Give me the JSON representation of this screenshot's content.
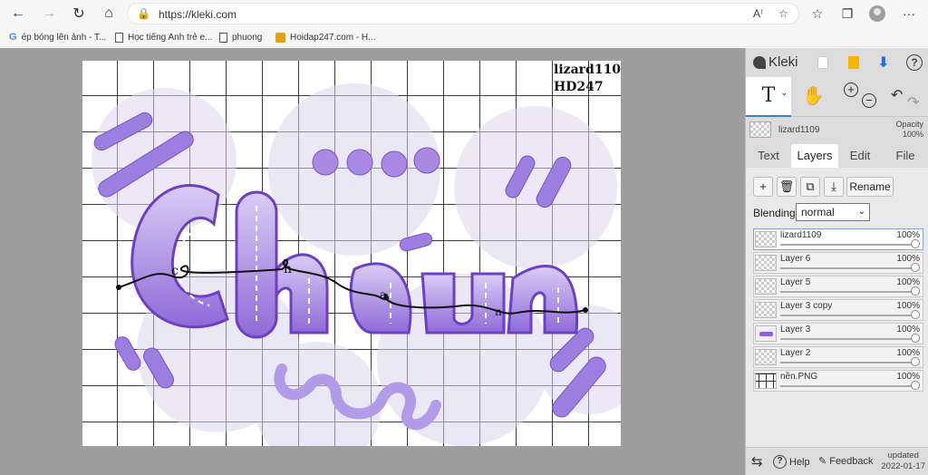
{
  "browser": {
    "url": "https://kleki.com",
    "bookmarks": [
      {
        "label": "ép bóng lên ảnh - T...",
        "icon": "google-icon"
      },
      {
        "label": "Học tiếng Anh trẻ e...",
        "icon": "page-icon"
      },
      {
        "label": "phuong",
        "icon": "page-icon"
      },
      {
        "label": "Hoidap247.com - H...",
        "icon": "hoidap-icon"
      }
    ]
  },
  "canvas": {
    "watermark_line1": "lizard1109",
    "watermark_line2": "HD247"
  },
  "panel": {
    "logo": "Kleki",
    "current_layer_name": "lizard1109",
    "opacity_label": "Opacity",
    "opacity_value": "100%",
    "tool_text_glyph": "T",
    "tabs": [
      {
        "label": "Text"
      },
      {
        "label": "Layers",
        "active": true
      },
      {
        "label": "Edit"
      },
      {
        "label": "File"
      }
    ],
    "rename_label": "Rename",
    "blending_label": "Blending",
    "blending_value": "normal",
    "layers": [
      {
        "name": "lizard1109",
        "opacity": "100%",
        "selected": true
      },
      {
        "name": "Layer 6",
        "opacity": "100%"
      },
      {
        "name": "Layer 5",
        "opacity": "100%"
      },
      {
        "name": "Layer 3 copy",
        "opacity": "100%"
      },
      {
        "name": "Layer 3",
        "opacity": "100%"
      },
      {
        "name": "Layer 2",
        "opacity": "100%"
      },
      {
        "name": "nền.PNG",
        "opacity": "100%"
      }
    ],
    "bottom": {
      "help_label": "Help",
      "feedback_label": "Feedback",
      "updated_label": "updated",
      "updated_date": "2022-01-17"
    }
  }
}
